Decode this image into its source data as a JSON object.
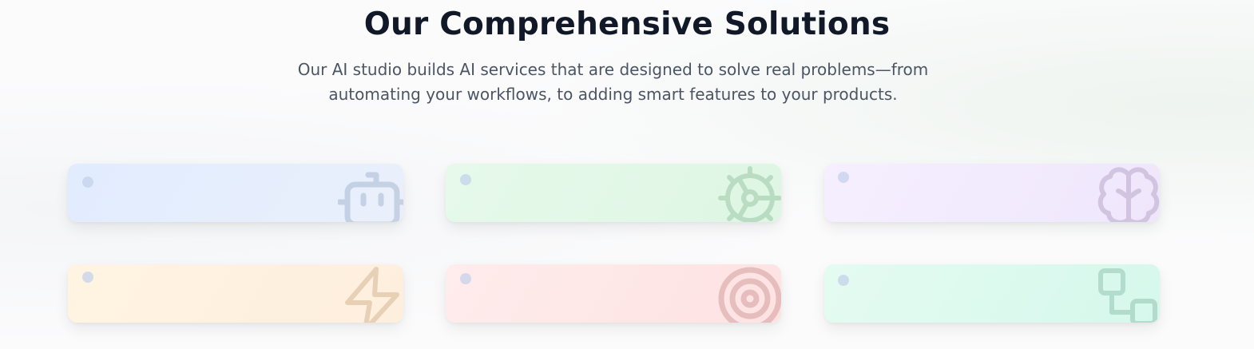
{
  "header": {
    "title": "Our Comprehensive Solutions",
    "subtitle": "Our AI studio builds AI services that are designed to solve real problems—from automating your workflows, to adding smart features to your products."
  },
  "cards": [
    {
      "icon": "bot-icon",
      "color": "#3b5b8a"
    },
    {
      "icon": "gear-icon",
      "color": "#1f7a3a"
    },
    {
      "icon": "brain-icon",
      "color": "#5a3d7a"
    },
    {
      "icon": "lightning-icon",
      "color": "#8a5a1a"
    },
    {
      "icon": "target-icon",
      "color": "#8a2a2a"
    },
    {
      "icon": "workflow-icon",
      "color": "#1f6a50"
    }
  ]
}
